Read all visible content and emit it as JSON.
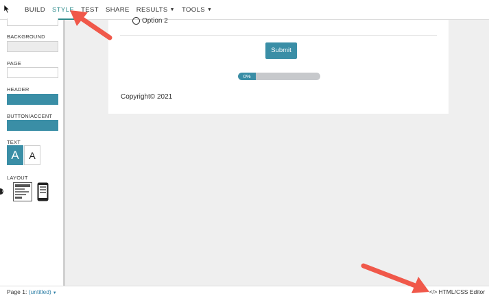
{
  "nav": {
    "items": [
      {
        "label": "BUILD",
        "active": false,
        "dropdown": false
      },
      {
        "label": "STYLE",
        "active": true,
        "dropdown": false
      },
      {
        "label": "TEST",
        "active": false,
        "dropdown": false
      },
      {
        "label": "SHARE",
        "active": false,
        "dropdown": false
      },
      {
        "label": "RESULTS",
        "active": false,
        "dropdown": true
      },
      {
        "label": "TOOLS",
        "active": false,
        "dropdown": true
      }
    ]
  },
  "sidebar": {
    "background_label": "BACKGROUND",
    "page_label": "PAGE",
    "header_label": "HEADER",
    "button_accent_label": "BUTTON/ACCENT",
    "text_label": "TEXT",
    "text_option_large": "A",
    "text_option_small": "A",
    "layout_label": "LAYOUT",
    "colors": {
      "background": "#ececec",
      "page": "#ffffff",
      "header": "#3a8ea6",
      "button_accent": "#3a8ea6"
    }
  },
  "form": {
    "option_label": "Option 2",
    "submit_label": "Submit",
    "progress_label": "0%",
    "progress_value": 0,
    "copyright": "Copyright© 2021"
  },
  "footer": {
    "page_prefix": "Page 1:",
    "page_name": "(untitled)",
    "editor_link": "HTML/CSS Editor"
  },
  "icons": {
    "cursor": "cursor-icon",
    "desktop_layout": "desktop-layout-icon",
    "mobile_layout": "mobile-layout-icon",
    "code": "code-icon"
  },
  "accent_color": "#3a8ea6",
  "annotation_color": "#f0584a"
}
